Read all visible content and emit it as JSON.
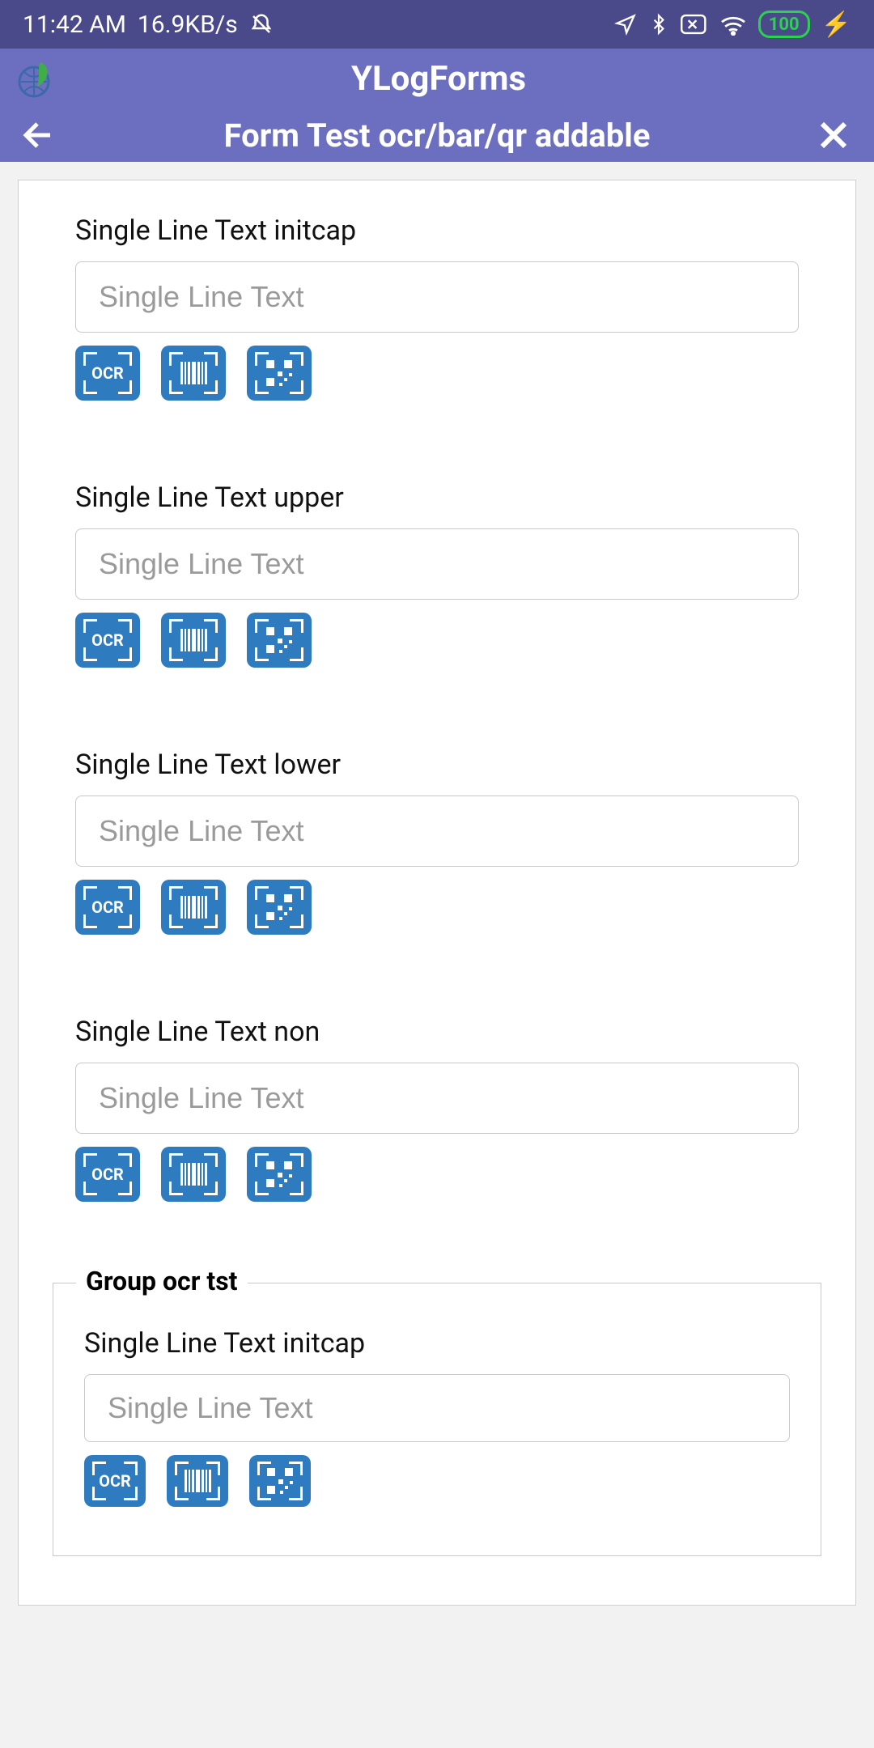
{
  "status": {
    "time": "11:42 AM",
    "net": "16.9KB/s",
    "battery": "100"
  },
  "header": {
    "app_title": "YLogForms",
    "form_title": "Form Test ocr/bar/qr addable"
  },
  "scan_labels": {
    "ocr": "OCR"
  },
  "fields": [
    {
      "label": "Single Line Text initcap",
      "placeholder": "Single Line Text",
      "value": ""
    },
    {
      "label": "Single Line Text upper",
      "placeholder": "Single Line Text",
      "value": ""
    },
    {
      "label": "Single Line Text lower",
      "placeholder": "Single Line Text",
      "value": ""
    },
    {
      "label": "Single Line Text non",
      "placeholder": "Single Line Text",
      "value": ""
    }
  ],
  "group": {
    "title": "Group ocr tst",
    "fields": [
      {
        "label": "Single Line Text initcap",
        "placeholder": "Single Line Text",
        "value": ""
      }
    ]
  }
}
